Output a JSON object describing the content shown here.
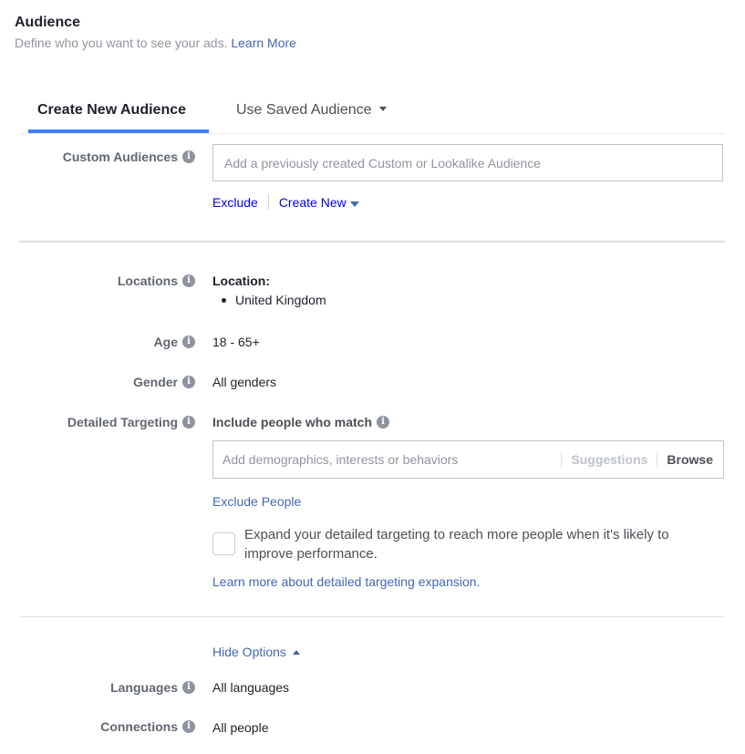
{
  "header": {
    "title": "Audience",
    "subtitle": "Define who you want to see your ads.",
    "learn_more": "Learn More"
  },
  "tabs": [
    {
      "label": "Create New Audience",
      "active": true
    },
    {
      "label": "Use Saved Audience",
      "active": false,
      "has_dropdown": true
    }
  ],
  "custom_audiences": {
    "label": "Custom Audiences",
    "placeholder": "Add a previously created Custom or Lookalike Audience",
    "exclude": "Exclude",
    "create_new": "Create New"
  },
  "locations": {
    "label": "Locations",
    "heading": "Location:",
    "items": [
      "United Kingdom"
    ]
  },
  "age": {
    "label": "Age",
    "value": "18 - 65+"
  },
  "gender": {
    "label": "Gender",
    "value": "All genders"
  },
  "detailed_targeting": {
    "label": "Detailed Targeting",
    "include_heading": "Include people who match",
    "placeholder": "Add demographics, interests or behaviors",
    "suggestions": "Suggestions",
    "browse": "Browse",
    "exclude_people": "Exclude People",
    "expand_text": "Expand your detailed targeting to reach more people when it's likely to improve performance.",
    "expand_checked": false,
    "learn_more_expansion": "Learn more about detailed targeting expansion."
  },
  "options": {
    "hide_options": "Hide Options"
  },
  "languages": {
    "label": "Languages",
    "value": "All languages"
  },
  "connections": {
    "label": "Connections",
    "value": "All people"
  },
  "icons": {
    "info": "i"
  },
  "colors": {
    "link": "#4267b2",
    "tab_accent": "#4080ff"
  }
}
